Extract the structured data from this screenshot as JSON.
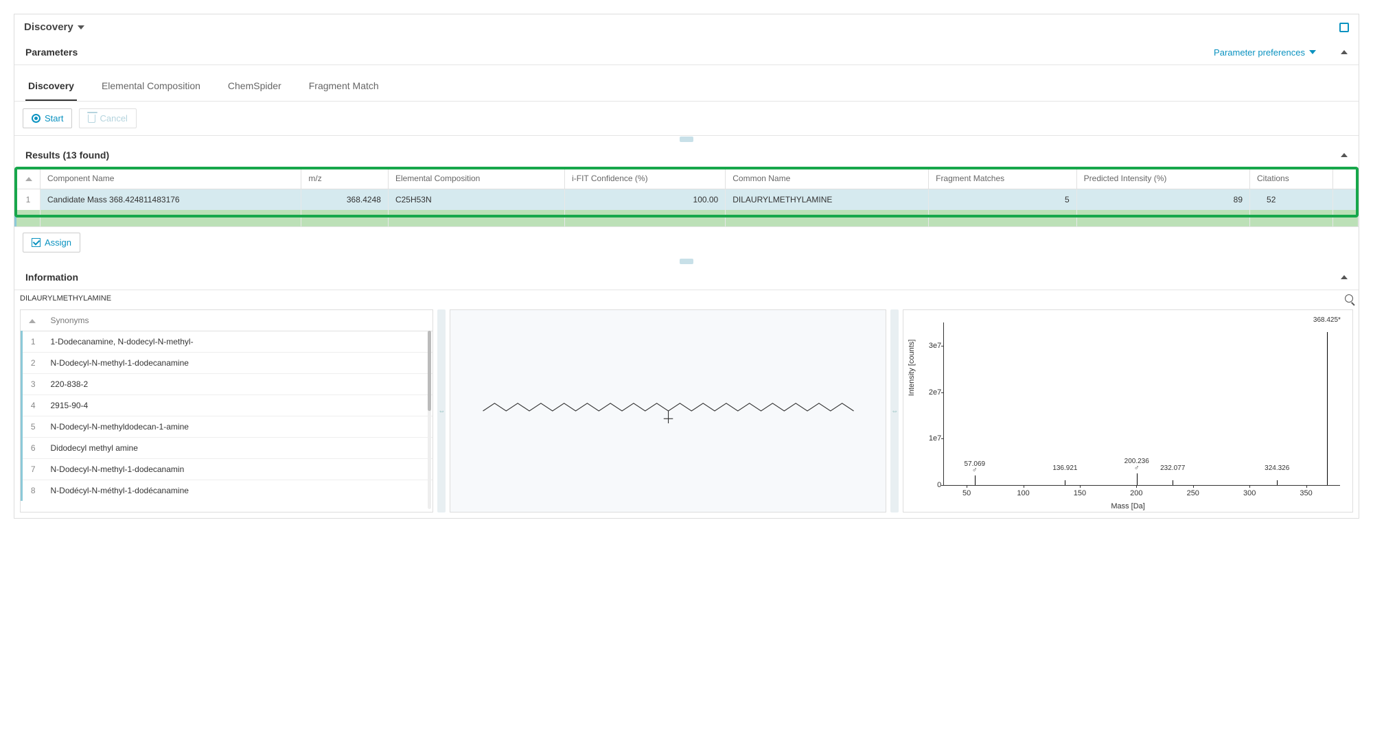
{
  "header": {
    "title": "Discovery"
  },
  "parameters": {
    "title": "Parameters",
    "preferences_label": "Parameter preferences"
  },
  "tabs": [
    {
      "label": "Discovery",
      "active": true
    },
    {
      "label": "Elemental Composition",
      "active": false
    },
    {
      "label": "ChemSpider",
      "active": false
    },
    {
      "label": "Fragment Match",
      "active": false
    }
  ],
  "toolbar": {
    "start_label": "Start",
    "cancel_label": "Cancel",
    "assign_label": "Assign"
  },
  "results": {
    "title": "Results (13 found)",
    "columns": [
      "Component Name",
      "m/z",
      "Elemental Composition",
      "i-FIT Confidence (%)",
      "Common Name",
      "Fragment Matches",
      "Predicted Intensity (%)",
      "Citations"
    ],
    "rows": [
      {
        "idx": "1",
        "component_name": "Candidate Mass 368.424811483176",
        "mz": "368.4248",
        "elemental": "C25H53N",
        "ifit": "100.00",
        "common": "DILAURYLMETHYLAMINE",
        "frag": "5",
        "pred": "89",
        "cit": "52"
      }
    ]
  },
  "information": {
    "title": "Information",
    "compound_name": "DILAURYLMETHYLAMINE",
    "synonyms_header": "Synonyms",
    "synonyms": [
      "1-Dodecanamine, N-dodecyl-N-methyl-",
      "N-Dodecyl-N-methyl-1-dodecanamine",
      "220-838-2",
      "2915-90-4",
      "N-Dodecyl-N-methyldodecan-1-amine",
      "Didodecyl methyl amine",
      "N-Dodecyl-N-methyl-1-dodecanamin",
      "N-Dodécyl-N-méthyl-1-dodécanamine"
    ]
  },
  "chart_data": {
    "type": "bar",
    "title": "",
    "xlabel": "Mass [Da]",
    "ylabel": "Intensity [counts]",
    "xlim": [
      30,
      380
    ],
    "ylim": [
      0,
      35000000.0
    ],
    "x_ticks": [
      50,
      100,
      150,
      200,
      250,
      300,
      350
    ],
    "y_ticks": [
      {
        "value": 0,
        "label": "0"
      },
      {
        "value": 10000000.0,
        "label": "1e7"
      },
      {
        "value": 20000000.0,
        "label": "2e7"
      },
      {
        "value": 30000000.0,
        "label": "3e7"
      }
    ],
    "peaks": [
      {
        "x": 57.069,
        "y": 2000000.0,
        "label": "57.069",
        "mark": "♂"
      },
      {
        "x": 136.921,
        "y": 1000000.0,
        "label": "136.921"
      },
      {
        "x": 200.236,
        "y": 2500000.0,
        "label": "200.236",
        "mark": "♂"
      },
      {
        "x": 232.077,
        "y": 1000000.0,
        "label": "232.077"
      },
      {
        "x": 324.326,
        "y": 1000000.0,
        "label": "324.326"
      },
      {
        "x": 368.425,
        "y": 33000000.0,
        "label": "368.425*"
      }
    ]
  }
}
